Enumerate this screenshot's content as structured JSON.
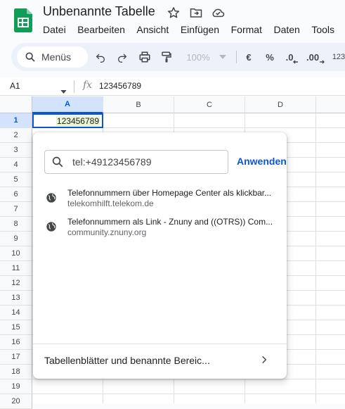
{
  "app": {
    "doc_title": "Unbenannte Tabelle",
    "icons": [
      "sheets-logo-icon",
      "star-icon",
      "move-to-folder-icon",
      "cloud-saved-icon"
    ]
  },
  "menu": {
    "items": [
      "Datei",
      "Bearbeiten",
      "Ansicht",
      "Einfügen",
      "Format",
      "Daten",
      "Tools"
    ]
  },
  "toolbar": {
    "search_label": "Menüs",
    "zoom": "100%",
    "currency": "€",
    "percent": "%",
    "decrease_decimals": ".0",
    "increase_decimals": ".00",
    "number_format": "123"
  },
  "formula_bar": {
    "cell_ref": "A1",
    "fx": "fx",
    "value": "123456789"
  },
  "grid": {
    "columns": [
      "A",
      "B",
      "C",
      "D"
    ],
    "rows": [
      "1",
      "2",
      "3",
      "4",
      "5",
      "6",
      "7",
      "8",
      "9",
      "10",
      "11",
      "12",
      "13",
      "14",
      "15",
      "16",
      "17",
      "18",
      "19",
      "20"
    ],
    "a1_value": "123456789"
  },
  "link_popup": {
    "search_value": "tel:+49123456789",
    "apply_label": "Anwenden",
    "suggestions": [
      {
        "title": "Telefonnummern über Homepage Center als klickbar...",
        "domain": "telekomhilft.telekom.de"
      },
      {
        "title": "Telefonnummern als Link - Znuny and ((OTRS)) Com...",
        "domain": "community.znuny.org"
      }
    ],
    "footer_label": "Tabellenblätter und benannte Bereic..."
  },
  "colors": {
    "accent": "#0b57d0",
    "selected_header": "#d3e3fd",
    "toolbar_bg": "#edf2fa",
    "sheets_green": "#0f9d58"
  }
}
